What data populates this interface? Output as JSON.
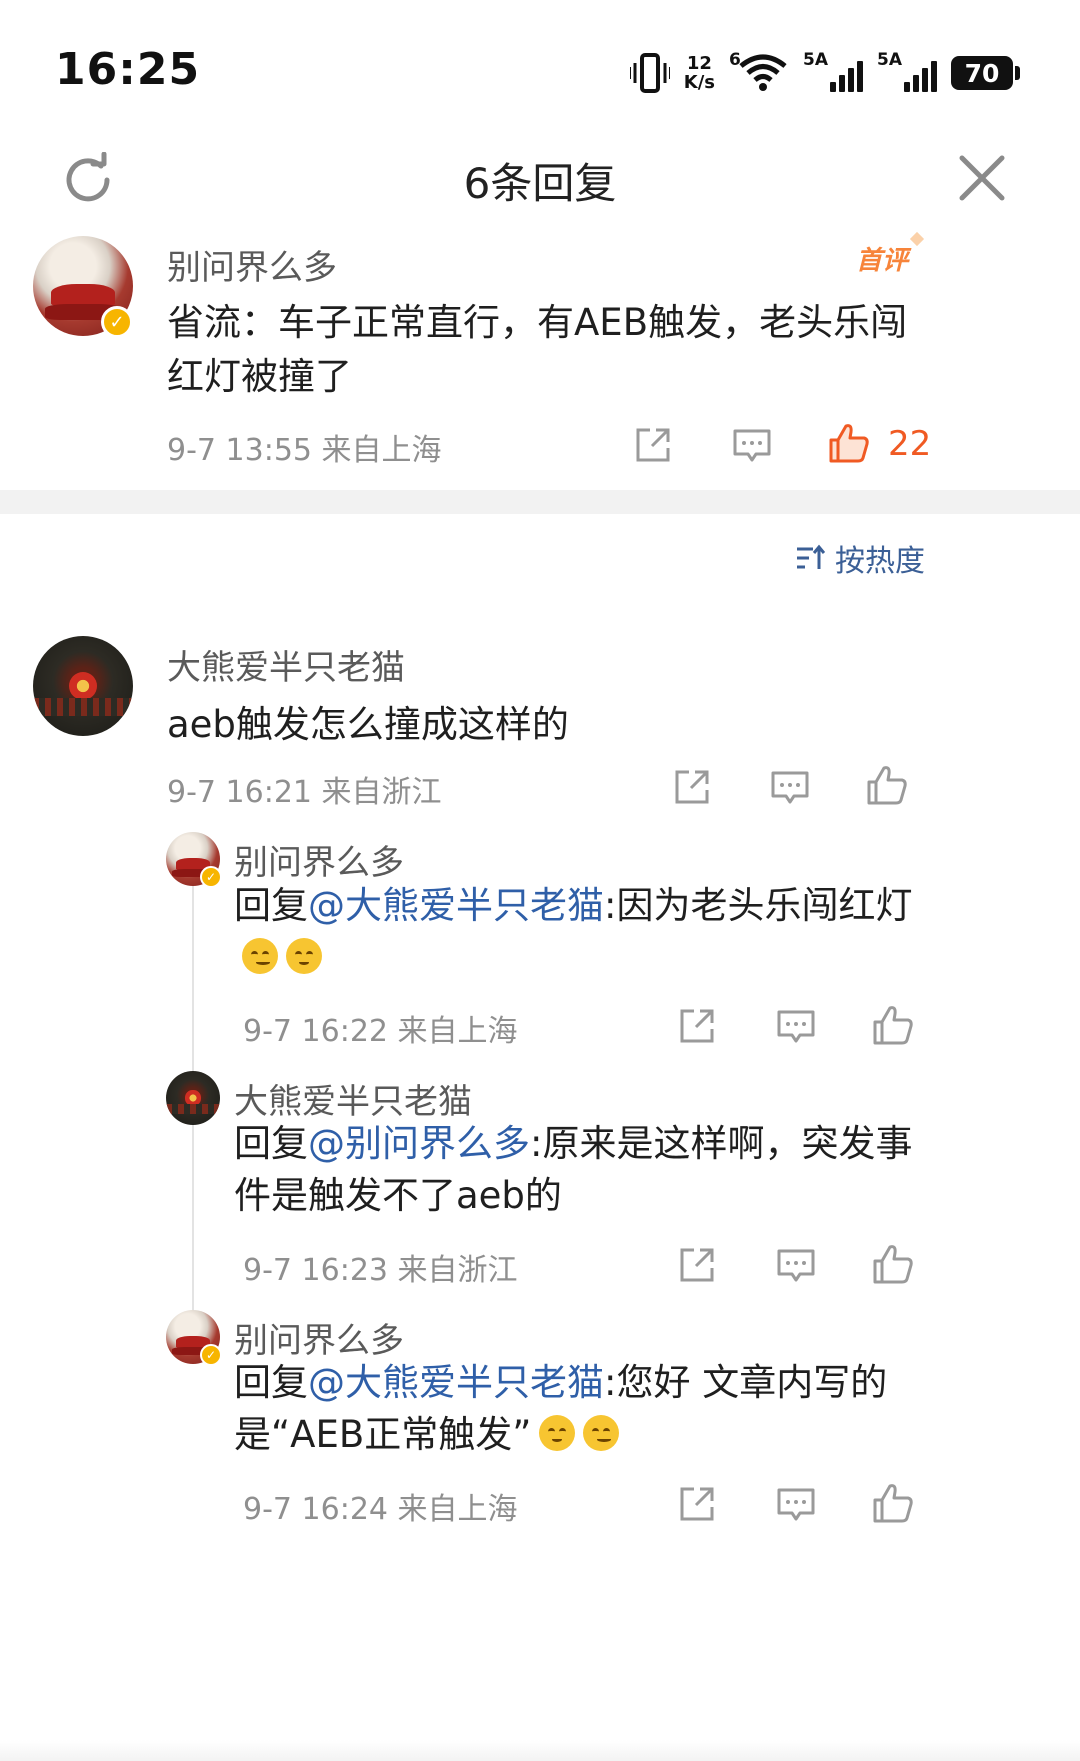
{
  "status_bar": {
    "time": "16:25",
    "net_speed_value": "12",
    "net_speed_unit": "K/s",
    "wifi_tag": "6",
    "sim1_tag": "5A",
    "sim2_tag": "5A",
    "battery": "70"
  },
  "header": {
    "title": "6条回复",
    "refresh_icon": "refresh-icon",
    "close_icon": "close-icon"
  },
  "main_comment": {
    "username": "别问界么多",
    "badge": "首评",
    "text": "省流：车子正常直行，有AEB触发，老头乐闯红灯被撞了",
    "time": "9-7 13:55",
    "location": "来自上海",
    "like_count": "22",
    "liked": true,
    "accent_color": "#f05a23"
  },
  "sort": {
    "label": "按热度",
    "icon": "sort-icon"
  },
  "reply_thread": {
    "username": "大熊爱半只老猫",
    "text": "aeb触发怎么撞成这样的",
    "time": "9-7 16:21",
    "location": "来自浙江",
    "sub_replies": [
      {
        "username": "别问界么多",
        "prefix": "回复",
        "mention": "@大熊爱半只老猫",
        "text": ":因为老头乐闯红灯",
        "time": "9-7 16:22",
        "location": "来自上海"
      },
      {
        "username": "大熊爱半只老猫",
        "prefix": "回复",
        "mention": "@别问界么多",
        "text": ":原来是这样啊，突发事件是触发不了aeb的",
        "time": "9-7 16:23",
        "location": "来自浙江"
      },
      {
        "username": "别问界么多",
        "prefix": "回复",
        "mention": "@大熊爱半只老猫",
        "text": ":您好 文章内写的是“AEB正常触发”",
        "time": "9-7 16:24",
        "location": "来自上海"
      }
    ]
  },
  "colors": {
    "mention": "#2f5fa8",
    "meta": "#8f8f8f",
    "like_active": "#f05a23",
    "verified": "#f7b500"
  }
}
